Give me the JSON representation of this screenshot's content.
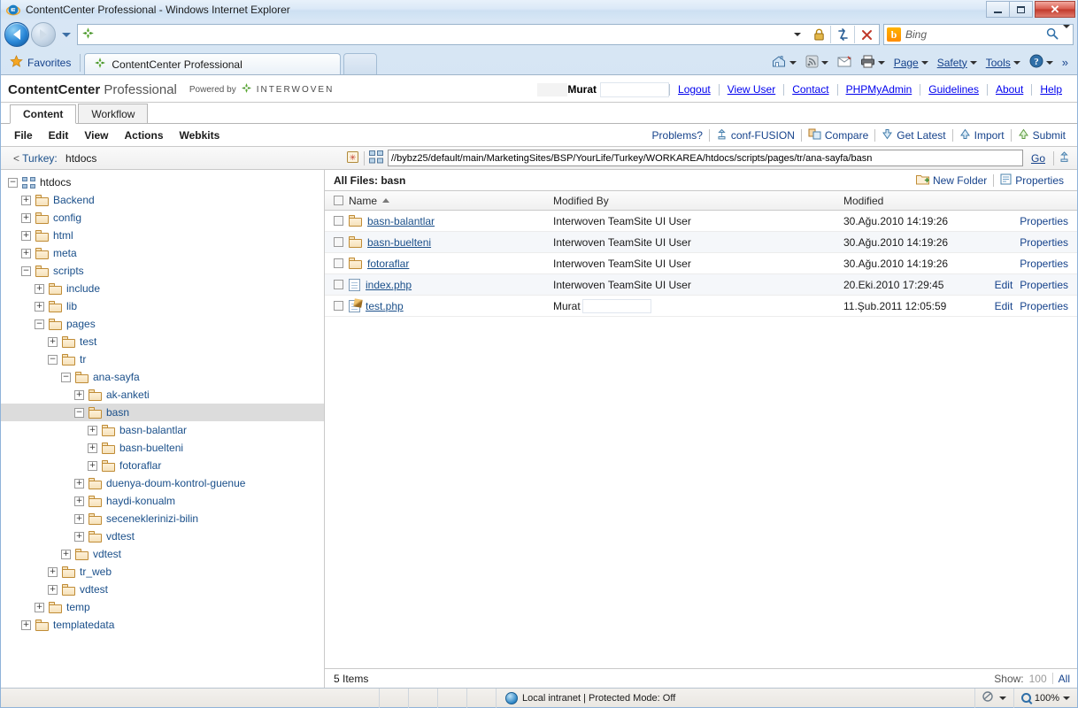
{
  "window": {
    "title": "ContentCenter Professional - Windows Internet Explorer",
    "minimize_label": "Minimize",
    "maximize_label": "Maximize",
    "close_label": "✕"
  },
  "browser": {
    "back_label": "Back",
    "forward_label": "Forward",
    "recent_pages_label": "Recent Pages",
    "address_value": "",
    "address_placeholder": "",
    "refresh_label": "Refresh",
    "stop_label": "Stop",
    "search_placeholder": "Bing",
    "search_value": "Bing",
    "search_engine_icon": "bing-icon",
    "favorites_label": "Favorites",
    "tabs": [
      {
        "label": "ContentCenter Professional",
        "icon": "interwoven-icon",
        "active": true
      },
      {
        "label": "",
        "icon": "new-tab-icon",
        "active": false
      }
    ],
    "command_bar": [
      {
        "label": "",
        "icon": "home-icon",
        "has_caret": true
      },
      {
        "label": "",
        "icon": "feeds-icon",
        "has_caret": true
      },
      {
        "label": "",
        "icon": "read-mail-icon",
        "has_caret": false
      },
      {
        "label": "",
        "icon": "print-icon",
        "has_caret": true
      },
      {
        "label": "Page",
        "icon": "",
        "has_caret": true
      },
      {
        "label": "Safety",
        "icon": "",
        "has_caret": true
      },
      {
        "label": "Tools",
        "icon": "",
        "has_caret": true
      },
      {
        "label": "",
        "icon": "help-icon",
        "has_caret": true
      }
    ],
    "overflow_label": "»"
  },
  "app": {
    "brand_bold": "ContentCenter",
    "brand_light": "Professional",
    "powered_by": "Powered by",
    "vendor": "INTERWOVEN",
    "user_name": "Murat",
    "header_links": [
      "Logout",
      "View User",
      "Contact",
      "PHPMyAdmin",
      "Guidelines",
      "About",
      "Help"
    ],
    "tabs": [
      {
        "label": "Content",
        "active": true
      },
      {
        "label": "Workflow",
        "active": false
      }
    ],
    "menus": [
      "File",
      "Edit",
      "View",
      "Actions",
      "Webkits"
    ],
    "actions": [
      {
        "label": "Problems?",
        "icon": ""
      },
      {
        "label": "conf-FUSION",
        "icon": "branch-icon"
      },
      {
        "label": "Compare",
        "icon": "compare-icon"
      },
      {
        "label": "Get Latest",
        "icon": "get-latest-icon"
      },
      {
        "label": "Import",
        "icon": "import-icon"
      },
      {
        "label": "Submit",
        "icon": "submit-icon"
      }
    ]
  },
  "pathbar": {
    "back_marker": "<",
    "branch_label": "Turkey:",
    "location": "htdocs",
    "path_value": "//bybz25/default/main/MarketingSites/BSP/YourLife/Turkey/WORKAREA/htdocs/scripts/pages/tr/ana-sayfa/basn",
    "go_label": "Go",
    "bookmark_icon": "bookmark-icon",
    "branch_icon": "branch-icon",
    "up_icon": "up-branch-icon"
  },
  "tree": [
    {
      "label": "htdocs",
      "depth": 0,
      "state": "minus",
      "icon": "site-icon",
      "selected": false,
      "root": true
    },
    {
      "label": "Backend",
      "depth": 1,
      "state": "plus",
      "icon": "folder-icon",
      "selected": false
    },
    {
      "label": "config",
      "depth": 1,
      "state": "plus",
      "icon": "folder-icon",
      "selected": false
    },
    {
      "label": "html",
      "depth": 1,
      "state": "plus",
      "icon": "folder-icon",
      "selected": false
    },
    {
      "label": "meta",
      "depth": 1,
      "state": "plus",
      "icon": "folder-icon",
      "selected": false
    },
    {
      "label": "scripts",
      "depth": 1,
      "state": "minus",
      "icon": "folder-icon",
      "selected": false
    },
    {
      "label": "include",
      "depth": 2,
      "state": "plus",
      "icon": "folder-icon",
      "selected": false
    },
    {
      "label": "lib",
      "depth": 2,
      "state": "plus",
      "icon": "folder-icon",
      "selected": false
    },
    {
      "label": "pages",
      "depth": 2,
      "state": "minus",
      "icon": "folder-icon",
      "selected": false
    },
    {
      "label": "test",
      "depth": 3,
      "state": "plus",
      "icon": "folder-icon",
      "selected": false
    },
    {
      "label": "tr",
      "depth": 3,
      "state": "minus",
      "icon": "folder-icon",
      "selected": false
    },
    {
      "label": "ana-sayfa",
      "depth": 4,
      "state": "minus",
      "icon": "folder-icon",
      "selected": false
    },
    {
      "label": "ak-anketi",
      "depth": 5,
      "state": "plus",
      "icon": "folder-icon",
      "selected": false
    },
    {
      "label": "basn",
      "depth": 5,
      "state": "minus",
      "icon": "folder-icon",
      "selected": true
    },
    {
      "label": "basn-balantlar",
      "depth": 6,
      "state": "plus",
      "icon": "folder-icon",
      "selected": false
    },
    {
      "label": "basn-buelteni",
      "depth": 6,
      "state": "plus",
      "icon": "folder-icon",
      "selected": false
    },
    {
      "label": "fotoraflar",
      "depth": 6,
      "state": "plus",
      "icon": "folder-icon",
      "selected": false
    },
    {
      "label": "duenya-doum-kontrol-guenue",
      "depth": 5,
      "state": "plus",
      "icon": "folder-icon",
      "selected": false
    },
    {
      "label": "haydi-konualm",
      "depth": 5,
      "state": "plus",
      "icon": "folder-icon",
      "selected": false
    },
    {
      "label": "seceneklerinizi-bilin",
      "depth": 5,
      "state": "plus",
      "icon": "folder-icon",
      "selected": false
    },
    {
      "label": "vdtest",
      "depth": 5,
      "state": "plus",
      "icon": "folder-icon",
      "selected": false
    },
    {
      "label": "vdtest",
      "depth": 4,
      "state": "plus",
      "icon": "folder-icon",
      "selected": false
    },
    {
      "label": "tr_web",
      "depth": 3,
      "state": "plus",
      "icon": "folder-icon",
      "selected": false
    },
    {
      "label": "vdtest",
      "depth": 3,
      "state": "plus",
      "icon": "folder-icon",
      "selected": false
    },
    {
      "label": "temp",
      "depth": 2,
      "state": "plus",
      "icon": "folder-icon",
      "selected": false
    },
    {
      "label": "templatedata",
      "depth": 1,
      "state": "plus",
      "icon": "folder-icon",
      "selected": false
    }
  ],
  "filelist": {
    "title": "All Files: basn",
    "new_folder_label": "New Folder",
    "properties_label": "Properties",
    "columns": {
      "name": "Name",
      "modified_by": "Modified By",
      "modified": "Modified",
      "sort": "asc"
    },
    "rows": [
      {
        "name": "basn-balantlar",
        "icon": "folder-icon",
        "type": "folder",
        "modified_by": "Interwoven TeamSite UI User",
        "modified_by_blank": false,
        "modified": "30.Ağu.2010 14:19:26",
        "edit_label": "",
        "properties_label": "Properties"
      },
      {
        "name": "basn-buelteni",
        "icon": "folder-icon",
        "type": "folder",
        "modified_by": "Interwoven TeamSite UI User",
        "modified_by_blank": false,
        "modified": "30.Ağu.2010 14:19:26",
        "edit_label": "",
        "properties_label": "Properties"
      },
      {
        "name": "fotoraflar",
        "icon": "folder-icon",
        "type": "folder",
        "modified_by": "Interwoven TeamSite UI User",
        "modified_by_blank": false,
        "modified": "30.Ağu.2010 14:19:26",
        "edit_label": "",
        "properties_label": "Properties"
      },
      {
        "name": "index.php",
        "icon": "document-icon",
        "type": "file",
        "modified_by": "Interwoven TeamSite UI User",
        "modified_by_blank": false,
        "modified": "20.Eki.2010 17:29:45",
        "edit_label": "Edit",
        "properties_label": "Properties"
      },
      {
        "name": "test.php",
        "icon": "document-checked-out-icon",
        "type": "file",
        "modified_by": "Murat",
        "modified_by_blank": true,
        "modified": "11.Şub.2011 12:05:59",
        "edit_label": "Edit",
        "properties_label": "Properties"
      }
    ],
    "footer": {
      "item_count": "5 Items",
      "show_label": "Show:",
      "show_value": "100",
      "show_all": "All"
    }
  },
  "statusbar": {
    "zone_text": "Local intranet | Protected Mode: Off",
    "zone_icon": "intranet-globe-icon",
    "privacy_icon": "privacy-icon",
    "zoom_icon": "zoom-icon",
    "zoom_level": "100%"
  },
  "colors": {
    "link": "#15428b",
    "tree_link": "#1a4f8a",
    "selection": "#dcdcdc",
    "row_alt": "#f5f7fa",
    "brand_green": "#5aa832",
    "chrome": "#cfe0f2"
  }
}
